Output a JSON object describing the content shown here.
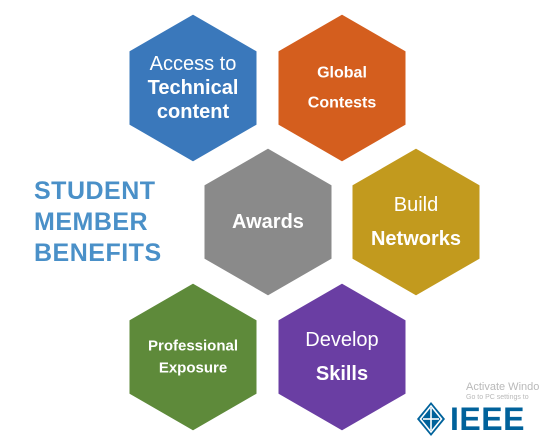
{
  "heading_lines": [
    "STUDENT",
    "MEMBER",
    "BENEFITS"
  ],
  "hexagons": [
    {
      "id": "access",
      "lines": [
        {
          "text": "Access to",
          "bold": false
        },
        {
          "text": "Technical",
          "bold": true
        },
        {
          "text": "content",
          "bold": true
        }
      ],
      "color": "#3a78bb"
    },
    {
      "id": "global",
      "lines": [
        {
          "text": "Global",
          "bold": true
        },
        {
          "text": "Contests",
          "bold": true
        }
      ],
      "color": "#d45e1e"
    },
    {
      "id": "awards",
      "lines": [
        {
          "text": "Awards",
          "bold": true
        }
      ],
      "color": "#8a8a8a"
    },
    {
      "id": "build",
      "lines": [
        {
          "text": "Build",
          "bold": false
        },
        {
          "text": "Networks",
          "bold": true
        }
      ],
      "color": "#c29a1e"
    },
    {
      "id": "professional",
      "lines": [
        {
          "text": "Professional",
          "bold": true
        },
        {
          "text": "Exposure",
          "bold": true
        }
      ],
      "color": "#5e8a3a"
    },
    {
      "id": "develop",
      "lines": [
        {
          "text": "Develop",
          "bold": false
        },
        {
          "text": "Skills",
          "bold": true
        }
      ],
      "color": "#6a3ea3"
    }
  ],
  "watermark": {
    "line1": "Activate Windo",
    "line2": "Go to PC settings to"
  },
  "logo": {
    "text": "IEEE",
    "color": "#00629b"
  }
}
